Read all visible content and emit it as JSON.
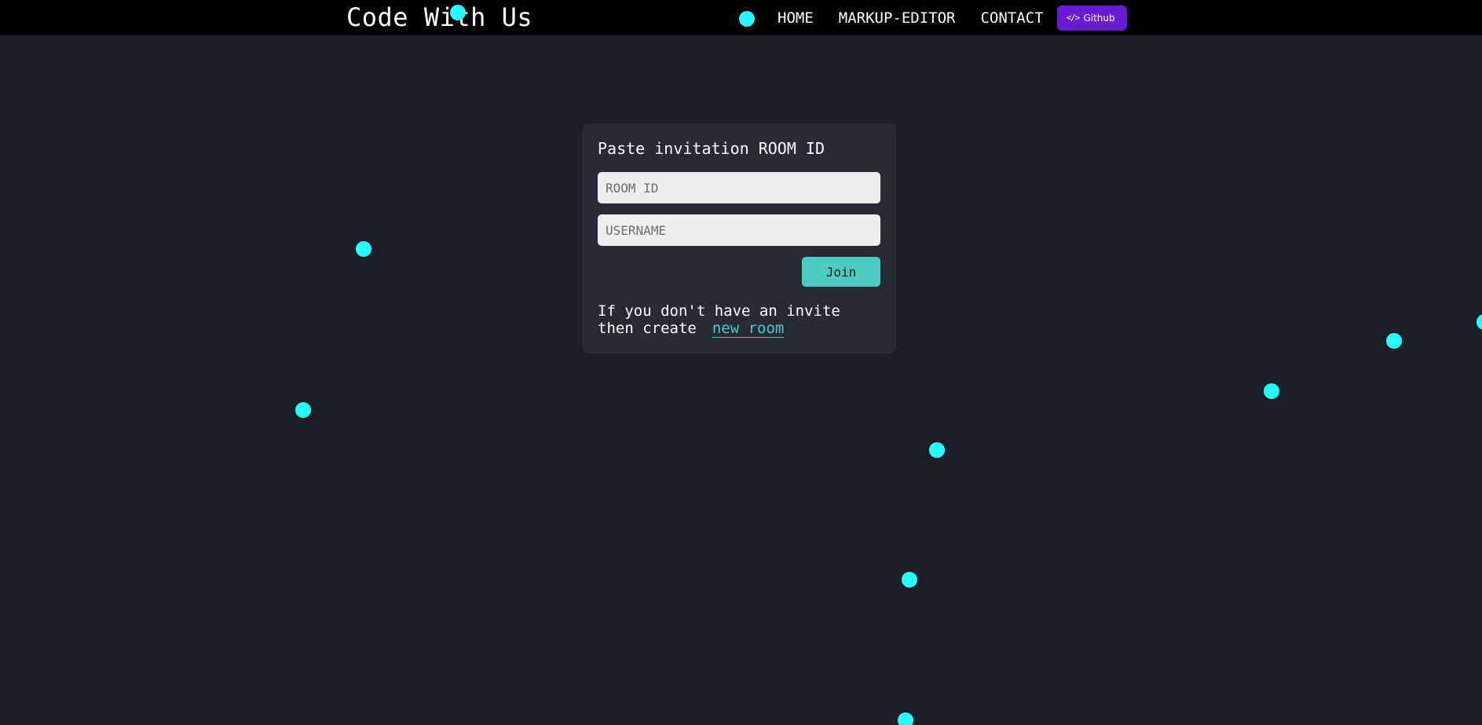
{
  "navbar": {
    "brand": "Code With Us",
    "links": [
      {
        "label": "HOME"
      },
      {
        "label": "MARKUP-EDITOR"
      },
      {
        "label": "CONTACT"
      }
    ],
    "github_label": "Github",
    "github_icon": "code-icon",
    "github_color": "#6a1bd8"
  },
  "join_card": {
    "title": "Paste invitation ROOM ID",
    "room_id_placeholder": "ROOM ID",
    "username_placeholder": "USERNAME",
    "join_label": "Join",
    "info_text": "If you don't have an invite then create",
    "create_link_label": "new room",
    "accent_color": "#4fcac1"
  },
  "background": {
    "color": "#1c1e29",
    "particle_color": "#27fbfb"
  }
}
